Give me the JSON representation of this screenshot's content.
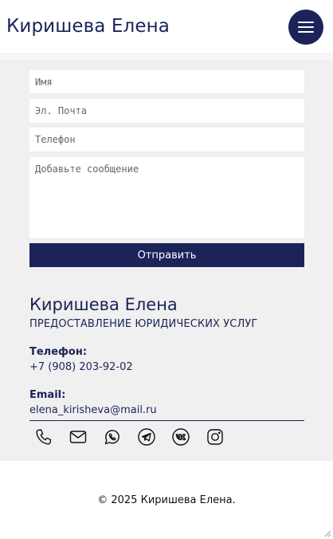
{
  "header": {
    "brand": "Киришева Елена"
  },
  "form": {
    "name_placeholder": "Имя",
    "email_placeholder": "Эл. Почта",
    "phone_placeholder": "Телефон",
    "message_placeholder": "Добавьте сообщение",
    "submit_label": "Отправить"
  },
  "contact": {
    "name": "Киришева Елена",
    "subtitle": "ПРЕДОСТАВЛЕНИЕ ЮРИДИЧЕСКИХ УСЛУГ",
    "phone_label": "Телефон:",
    "phone_value": "+7 (908) 203-92-02",
    "email_label": "Email:",
    "email_value": "elena_kirisheva@mail.ru"
  },
  "socials": [
    "phone-icon",
    "mail-icon",
    "whatsapp-icon",
    "telegram-icon",
    "vk-icon",
    "instagram-icon"
  ],
  "footer": {
    "copyright": "© 2025 Киришева Елена."
  },
  "colors": {
    "brand": "#1b2359",
    "section_bg": "#f0f0f0"
  }
}
